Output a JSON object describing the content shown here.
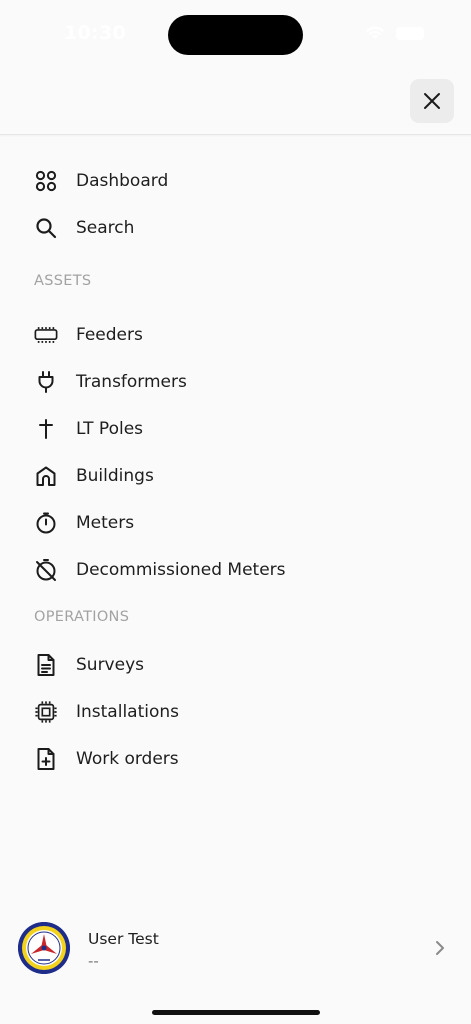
{
  "status_bar": {
    "time": "10:30"
  },
  "menu": {
    "primary": [
      {
        "label": "Dashboard",
        "icon": "dashboard-grid-icon"
      },
      {
        "label": "Search",
        "icon": "search-icon"
      }
    ],
    "sections": [
      {
        "title": "ASSETS",
        "items": [
          {
            "label": "Feeders",
            "icon": "feeder-icon"
          },
          {
            "label": "Transformers",
            "icon": "plug-icon"
          },
          {
            "label": "LT Poles",
            "icon": "pole-icon"
          },
          {
            "label": "Buildings",
            "icon": "building-icon"
          },
          {
            "label": "Meters",
            "icon": "meter-icon"
          },
          {
            "label": "Decommissioned Meters",
            "icon": "meter-off-icon"
          }
        ]
      },
      {
        "title": "OPERATIONS",
        "items": [
          {
            "label": "Surveys",
            "icon": "survey-document-icon"
          },
          {
            "label": "Installations",
            "icon": "chip-icon"
          },
          {
            "label": "Work orders",
            "icon": "file-plus-icon"
          }
        ]
      }
    ]
  },
  "user": {
    "name": "User Test",
    "subtitle": "--"
  },
  "colors": {
    "background": "#fafafa",
    "close_button_bg": "#ececec",
    "section_header": "#a3a3a3",
    "text": "#1e1e1e",
    "logo_blue": "#1f2d8a"
  }
}
